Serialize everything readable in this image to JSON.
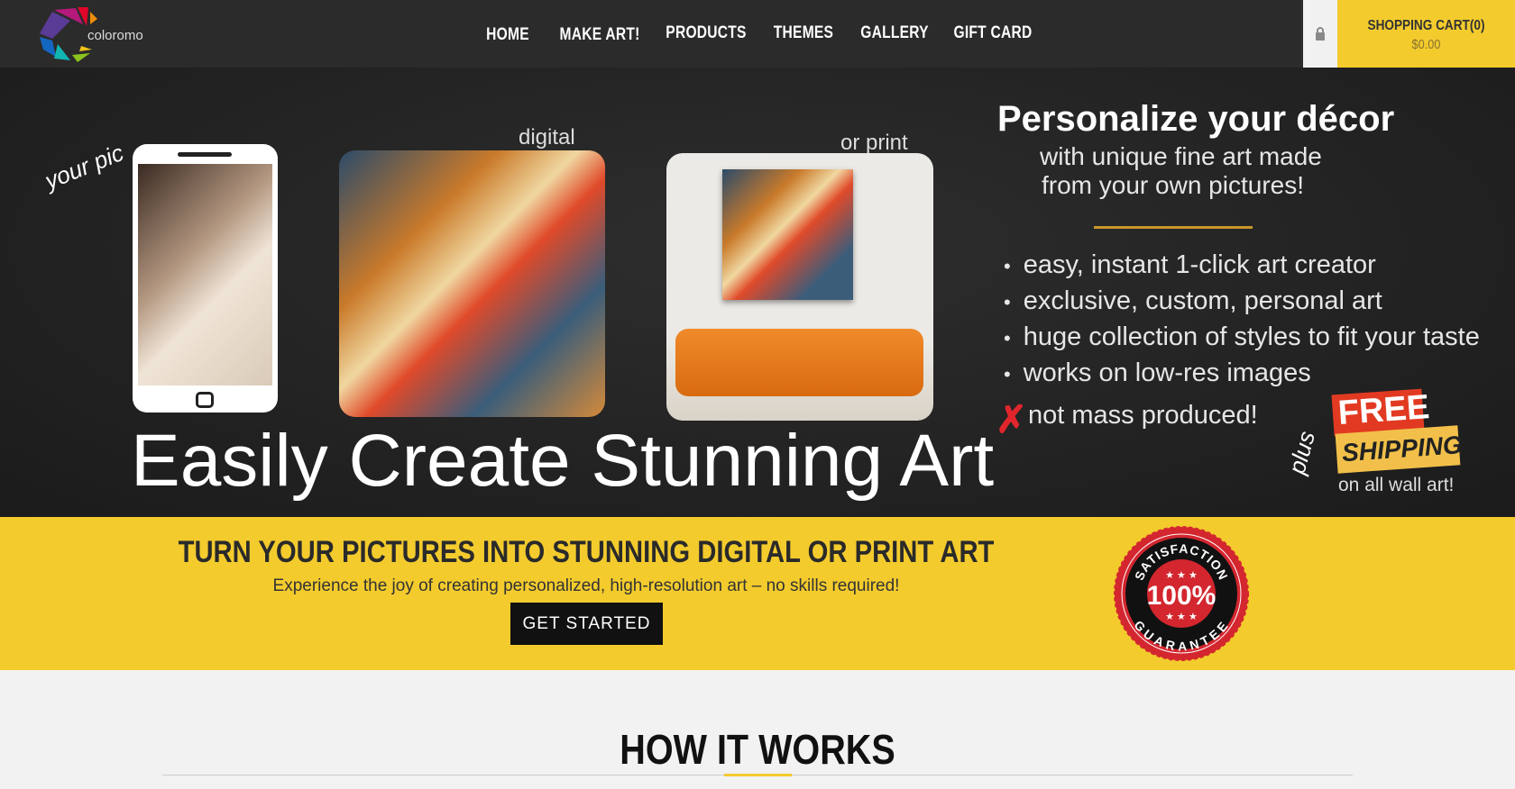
{
  "header": {
    "logo_text": "coloromo",
    "nav": [
      "HOME",
      "MAKE ART!",
      "PRODUCTS",
      "THEMES",
      "GALLERY",
      "GIFT CARD"
    ],
    "lock_icon": "lock-icon",
    "cart": {
      "title": "SHOPPING CART(0)",
      "total": "$0.00"
    }
  },
  "hero": {
    "your_pic": "your pic",
    "digital": "digital",
    "or_print": "or print",
    "headline": "Easily Create Stunning Art",
    "title": "Personalize your décor",
    "subtitle_1": "with unique fine art made",
    "subtitle_2": "from your own pictures!",
    "bullets": [
      "easy, instant 1-click art creator",
      "exclusive, custom, personal art",
      "huge collection of styles to fit your taste",
      "works on low-res images"
    ],
    "not_mass": "not mass produced!",
    "plus": "plus",
    "free": "FREE",
    "shipping": "SHIPPING",
    "wall": "on all wall art!"
  },
  "promo": {
    "heading": "TURN YOUR PICTURES INTO STUNNING DIGITAL OR PRINT ART",
    "subtext": "Experience the joy of creating personalized, high-resolution art – no skills required!",
    "button": "GET STARTED",
    "badge": {
      "top": "SATISFACTION",
      "center": "100%",
      "bottom": "GUARANTEE"
    }
  },
  "how": {
    "title": "HOW IT WORKS"
  },
  "colors": {
    "nav_bg": "#2b2b2b",
    "accent": "#f3cb2d",
    "badge_red": "#d3262f"
  }
}
